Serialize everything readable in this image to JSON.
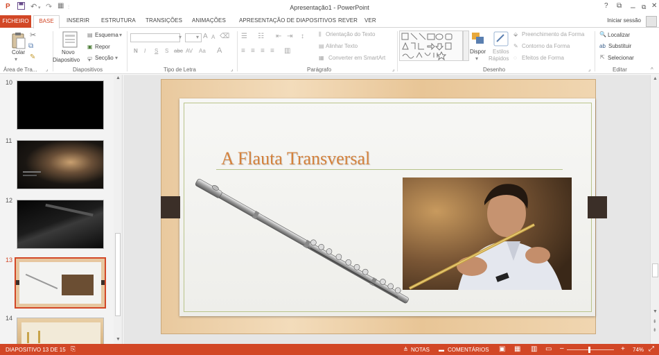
{
  "window": {
    "title": "Apresentação1 - PowerPoint",
    "help": "?",
    "minimize": "–",
    "close": "✕"
  },
  "tabs": {
    "file": "FICHEIRO",
    "home": "BASE",
    "insert": "INSERIR",
    "design": "ESTRUTURA",
    "transitions": "TRANSIÇÕES",
    "animations": "ANIMAÇÕES",
    "slideshow": "APRESENTAÇÃO DE DIAPOSITIVOS",
    "review": "REVER",
    "view": "VER",
    "signin": "Iniciar sessão"
  },
  "ribbon": {
    "clipboard": {
      "paste": "Colar",
      "group": "Área de Tra..."
    },
    "slides": {
      "new_slide_1": "Novo",
      "new_slide_2": "Diapositivo",
      "layout": "Esquema",
      "reset": "Repor",
      "section": "Secção",
      "group": "Diapositivos"
    },
    "font": {
      "bold": "N",
      "italic": "I",
      "underline": "S",
      "shadow": "S",
      "strike": "abc",
      "spacing": "AV",
      "case": "Aa",
      "color": "A",
      "grow": "A",
      "shrink": "A",
      "group": "Tipo de Letra"
    },
    "paragraph": {
      "text_direction": "Orientação do Texto",
      "align_text": "Alinhar Texto",
      "smartart": "Converter em SmartArt",
      "group": "Parágrafo"
    },
    "drawing": {
      "arrange": "Dispor",
      "quick_styles_1": "Estilos",
      "quick_styles_2": "Rápidos",
      "shape_fill": "Preenchimento da Forma",
      "shape_outline": "Contorno da Forma",
      "shape_effects": "Efeitos de Forma",
      "group": "Desenho"
    },
    "editing": {
      "find": "Localizar",
      "replace": "Substituir",
      "select": "Selecionar",
      "group": "Editar"
    }
  },
  "thumbnails": [
    {
      "num": "10"
    },
    {
      "num": "11"
    },
    {
      "num": "12"
    },
    {
      "num": "13"
    },
    {
      "num": "14"
    }
  ],
  "slide": {
    "title": "A Flauta Transversal"
  },
  "statusbar": {
    "slide_info": "DIAPOSITIVO 13 DE 15",
    "notes": "NOTAS",
    "comments": "COMENTÁRIOS",
    "zoom": "74%"
  },
  "colors": {
    "accent": "#d24726",
    "title": "#d5823c"
  }
}
